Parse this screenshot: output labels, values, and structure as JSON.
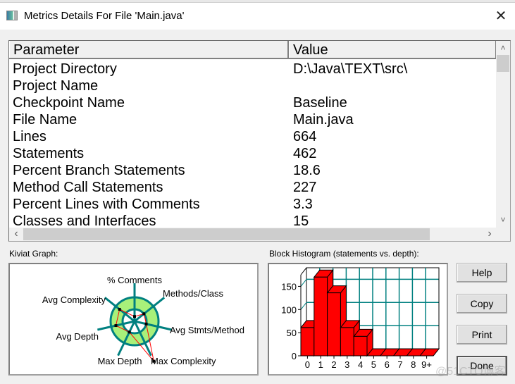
{
  "window": {
    "title": "Metrics Details For File 'Main.java'",
    "icon": "app-window-icon",
    "close_glyph": "✕"
  },
  "table": {
    "columns": [
      "Parameter",
      "Value"
    ],
    "rows": [
      {
        "parameter": "Project Directory",
        "value": "D:\\Java\\TEXT\\src\\"
      },
      {
        "parameter": "Project Name",
        "value": ""
      },
      {
        "parameter": "Checkpoint Name",
        "value": "Baseline"
      },
      {
        "parameter": "File Name",
        "value": "Main.java"
      },
      {
        "parameter": "Lines",
        "value": "664"
      },
      {
        "parameter": "Statements",
        "value": "462"
      },
      {
        "parameter": "Percent Branch Statements",
        "value": "18.6"
      },
      {
        "parameter": "Method Call Statements",
        "value": "227"
      },
      {
        "parameter": "Percent Lines with Comments",
        "value": "3.3"
      },
      {
        "parameter": "Classes and Interfaces",
        "value": "15"
      }
    ],
    "scroll": {
      "up": "˄",
      "down": "˅",
      "left": "‹",
      "right": "›"
    }
  },
  "kiviat": {
    "label": "Kiviat Graph:",
    "colors": {
      "band": "#a8f07a",
      "axis": "#008080",
      "polygon": "#ff0000"
    },
    "axes": [
      "% Comments",
      "Methods/Class",
      "Avg Stmts/Method",
      "Max Complexity",
      "Max Depth",
      "Avg Depth",
      "Avg Complexity"
    ],
    "values": [
      0.2,
      0.5,
      0.5,
      1.85,
      0.5,
      0.8,
      0.8
    ],
    "band_inner": 0.5,
    "band_outer": 1.0
  },
  "histogram": {
    "label": "Block Histogram (statements vs. depth):",
    "colors": {
      "bar": "#ff0000",
      "grid": "#008080"
    }
  },
  "chart_data": {
    "type": "bar",
    "title": "Block Histogram (statements vs. depth):",
    "xlabel": "depth",
    "ylabel": "statements",
    "categories": [
      "0",
      "1",
      "2",
      "3",
      "4",
      "5",
      "6",
      "7",
      "8",
      "9+"
    ],
    "values": [
      61,
      170,
      136,
      61,
      42,
      0,
      0,
      0,
      0,
      0
    ],
    "yticks": [
      0,
      50,
      100,
      150
    ],
    "ylim": [
      0,
      175
    ],
    "grid": true,
    "style": "3d"
  },
  "buttons": {
    "help": "Help",
    "copy": "Copy",
    "print": "Print",
    "done": "Done"
  },
  "watermark": "@51CTO博客"
}
